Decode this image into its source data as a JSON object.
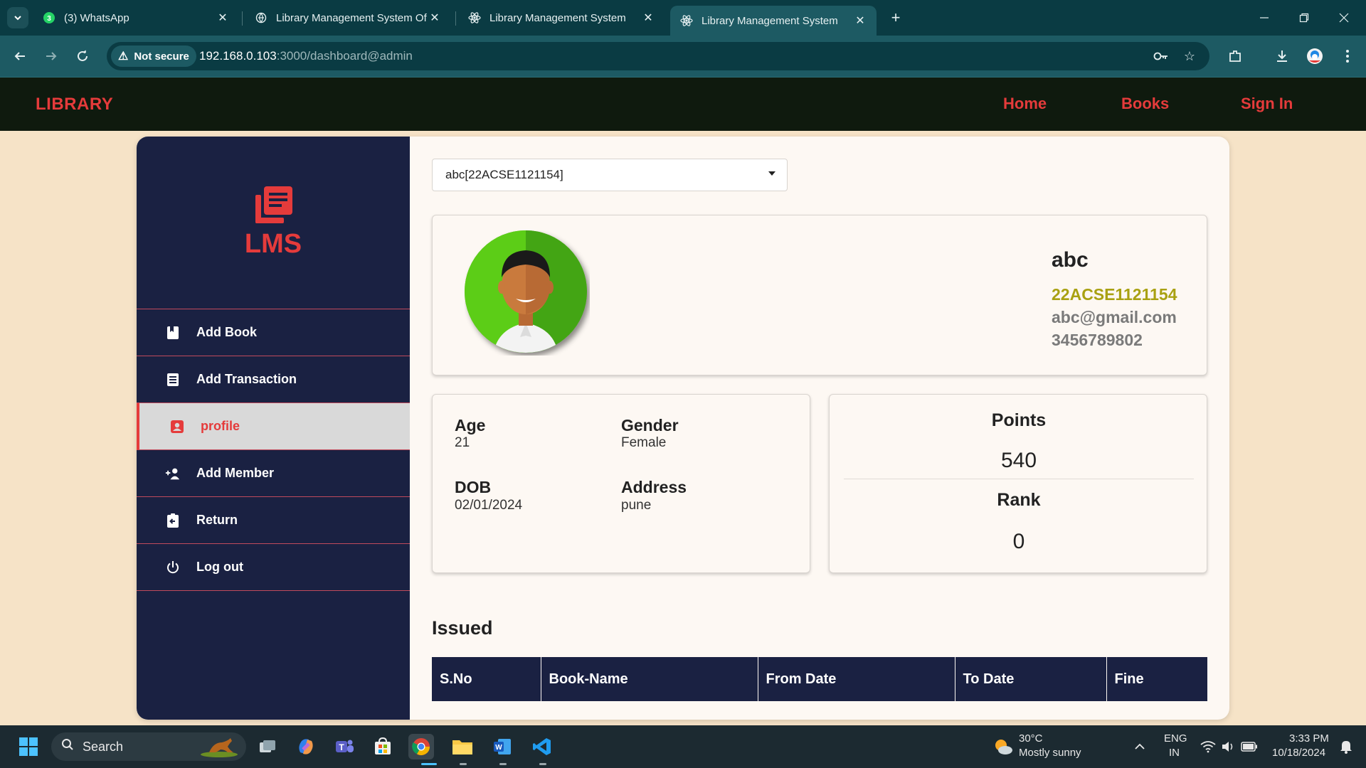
{
  "browser": {
    "tabs": [
      {
        "title": "(3) WhatsApp",
        "badge": "3",
        "icon": "whatsapp-icon"
      },
      {
        "title": "Library Management System Of",
        "icon": "web-icon"
      },
      {
        "title": "Library Management System",
        "icon": "react-icon"
      },
      {
        "title": "Library Management System",
        "icon": "react-icon",
        "active": true
      }
    ],
    "security_label": "Not secure",
    "url_host": "192.168.0.103",
    "url_path": ":3000/dashboard@admin"
  },
  "header": {
    "brand": "LIBRARY",
    "nav": [
      "Home",
      "Books",
      "Sign In"
    ]
  },
  "sidebar": {
    "logo_text": "LMS",
    "items": [
      {
        "label": "Add Book",
        "icon": "book-icon"
      },
      {
        "label": "Add Transaction",
        "icon": "list-icon"
      },
      {
        "label": "profile",
        "icon": "profile-icon",
        "active": true
      },
      {
        "label": "Add Member",
        "icon": "add-person-icon"
      },
      {
        "label": "Return",
        "icon": "return-icon"
      },
      {
        "label": "Log out",
        "icon": "power-icon"
      }
    ]
  },
  "member_select": {
    "value": "abc[22ACSE1121154]"
  },
  "profile": {
    "name": "abc",
    "id": "22ACSE1121154",
    "email": "abc@gmail.com",
    "phone": "3456789802"
  },
  "details": {
    "age_label": "Age",
    "age": "21",
    "gender_label": "Gender",
    "gender": "Female",
    "dob_label": "DOB",
    "dob": "02/01/2024",
    "address_label": "Address",
    "address": "pune"
  },
  "stats": {
    "points_label": "Points",
    "points": "540",
    "rank_label": "Rank",
    "rank": "0"
  },
  "issued": {
    "title": "Issued",
    "columns": [
      "S.No",
      "Book-Name",
      "From Date",
      "To Date",
      "Fine"
    ]
  },
  "taskbar": {
    "search_placeholder": "Search",
    "weather_temp": "30°C",
    "weather_desc": "Mostly sunny",
    "lang_top": "ENG",
    "lang_bottom": "IN",
    "time": "3:33 PM",
    "date": "10/18/2024"
  },
  "colors": {
    "accent_red": "#e53b3b",
    "sidebar_navy": "#1a2142",
    "id_olive": "#a9a112",
    "page_bg": "#f6e3c7"
  }
}
